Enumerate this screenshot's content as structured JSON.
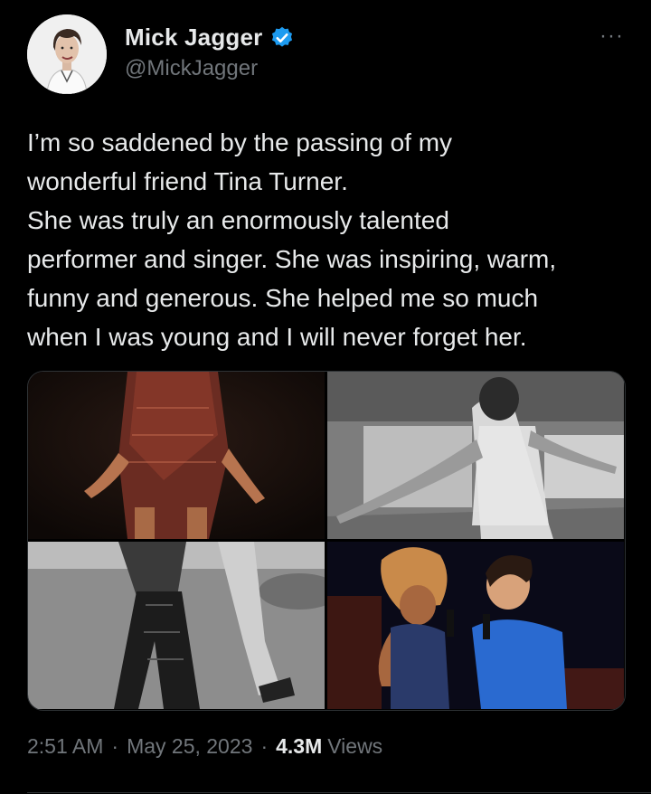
{
  "author": {
    "name": "Mick Jagger",
    "handle": "@MickJagger",
    "verified": true,
    "verified_color": "#1d9bf0"
  },
  "more_label": "···",
  "tweet": {
    "lines": [
      "I’m so saddened by the passing of my",
      "wonderful friend Tina Turner.",
      "She was truly an enormously talented",
      "performer and singer. She was inspiring, warm,",
      "funny and generous. She helped me so much",
      "when I was young and I will never forget her."
    ]
  },
  "media": {
    "count": 4
  },
  "meta": {
    "time": "2:51 AM",
    "separator": "·",
    "date": "May 25, 2023",
    "views_count": "4.3M",
    "views_label": "Views"
  },
  "colors": {
    "background": "#000000",
    "text": "#e7e9ea",
    "secondary": "#71767b"
  }
}
